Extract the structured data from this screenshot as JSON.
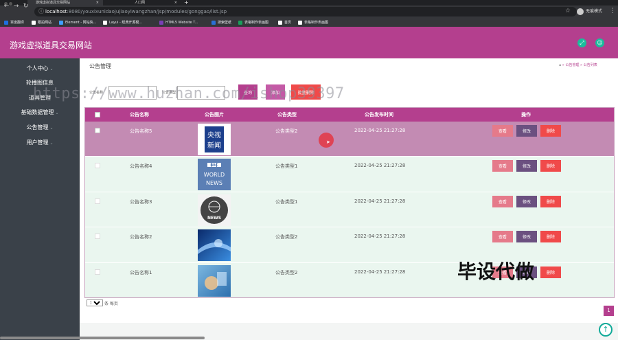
{
  "browser": {
    "tabs": [
      {
        "label": "游戏虚拟道具交易网站",
        "close": "×"
      },
      {
        "label": "人口网",
        "close": "×"
      }
    ],
    "new_tab": "+",
    "url_host": "localhost",
    "url_path": ":8080/youxixunidaojujiaoyiwangzhan/jsp/modules/gonggao/list.jsp",
    "profile_label": "无痕模式",
    "bookmarks": [
      {
        "label": "百度翻译",
        "color": "#1e6fe0"
      },
      {
        "label": "跟拍网站",
        "color": "#ffffff"
      },
      {
        "label": "Element - 网站快...",
        "color": "#409eff"
      },
      {
        "label": "Layui - 经典开源模...",
        "color": "#ffffff"
      },
      {
        "label": "HTML5 Website T...",
        "color": "#7b3fb6"
      },
      {
        "label": "搜索壁纸",
        "color": "#2a6fd6"
      },
      {
        "label": "表格制作表画图",
        "color": "#1a9e5a"
      },
      {
        "label": "首页",
        "color": "#ffffff"
      },
      {
        "label": "表格制作表画图",
        "color": "#ffffff"
      }
    ]
  },
  "app": {
    "site_title": "游戏虚拟道具交易网站",
    "header_icons": [
      "expand-icon",
      "user-icon"
    ]
  },
  "sidebar": {
    "items": [
      {
        "label": "个人中心",
        "caret": "⌄"
      },
      {
        "label": "轮播图信息",
        "caret": ""
      },
      {
        "label": "道具管理",
        "caret": ""
      },
      {
        "label": "基础数据管理",
        "caret": "⌄"
      },
      {
        "label": "公告管理",
        "caret": "⌄"
      },
      {
        "label": "用户管理",
        "caret": "⌄"
      }
    ]
  },
  "page": {
    "title": "公告管理",
    "breadcrumb": [
      "公告管理",
      "公告列表"
    ],
    "breadcrumb_sep": "»",
    "search": {
      "name_label": "公告名称",
      "type_label": "公告类型",
      "name_value": "",
      "type_value": "",
      "btn_search": "查询",
      "btn_add": "添加",
      "btn_delete": "批量删除"
    },
    "watermark": "https://www.huzhan.com/ishop39397",
    "overlay_text": "毕设代做"
  },
  "table": {
    "headers": [
      "公告名称",
      "公告图片",
      "公告类型",
      "公告发布时间",
      "操作"
    ],
    "rows": [
      {
        "name": "公告名称5",
        "type": "公告类型2",
        "time": "2022-04-25 21:27:28",
        "img": "cctv"
      },
      {
        "name": "公告名称4",
        "type": "公告类型1",
        "time": "2022-04-25 21:27:28",
        "img": "bbc"
      },
      {
        "name": "公告名称3",
        "type": "公告类型1",
        "time": "2022-04-25 21:27:28",
        "img": "globe"
      },
      {
        "name": "公告名称2",
        "type": "公告类型2",
        "time": "2022-04-25 21:27:28",
        "img": "blue"
      },
      {
        "name": "公告名称1",
        "type": "公告类型2",
        "time": "2022-04-25 21:27:28",
        "img": "tech"
      }
    ],
    "actions": {
      "view": "查看",
      "edit": "修改",
      "delete": "删除"
    },
    "thumb_text": {
      "cctv": "央视新闻",
      "bbc_logo": "BBC",
      "bbc_line1": "WORLD",
      "bbc_line2": "NEWS",
      "globe": "NEWS"
    }
  },
  "pager": {
    "page_size": "10",
    "page_size_label": "条 每页",
    "current_page": "1"
  },
  "colors": {
    "primary": "#b43f8e",
    "sidebar": "#3a4149",
    "row_selected": "#c38bb3",
    "row_alt": "#eaf6ef",
    "view": "#e57a8a",
    "edit": "#6b5080",
    "delete": "#f04a4a"
  }
}
